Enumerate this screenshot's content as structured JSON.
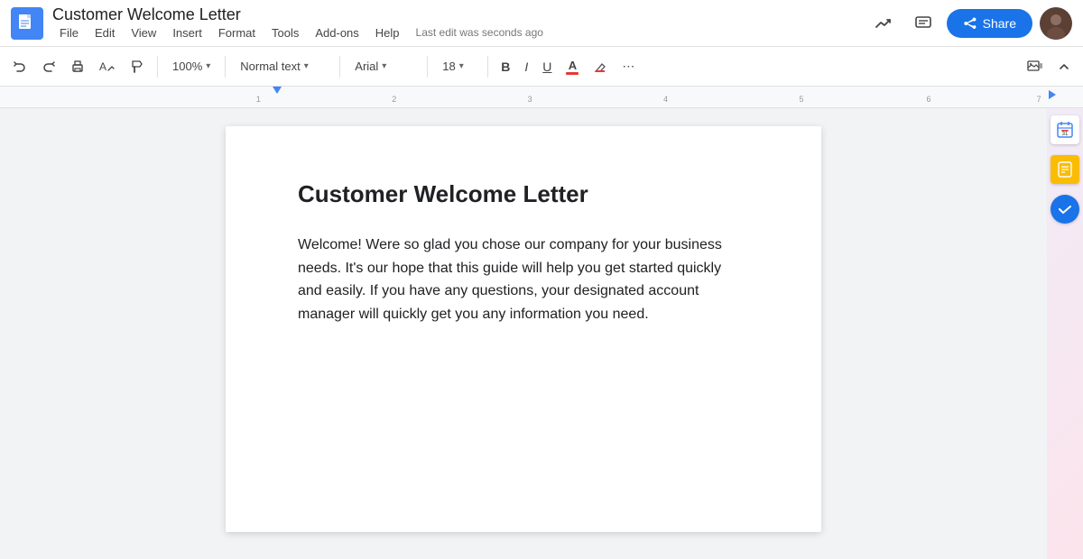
{
  "app": {
    "title": "Customer Welcome Letter",
    "doc_icon_color": "#4285f4",
    "last_edit": "Last edit was seconds ago"
  },
  "menu": {
    "items": [
      "File",
      "Edit",
      "View",
      "Insert",
      "Format",
      "Tools",
      "Add-ons",
      "Help"
    ]
  },
  "toolbar": {
    "zoom": "100%",
    "style": "Normal text",
    "font": "Arial",
    "size": "18",
    "bold": "B",
    "italic": "I",
    "underline": "U",
    "more": "⋯"
  },
  "share_button": {
    "label": "Share"
  },
  "document": {
    "title": "Customer Welcome Letter",
    "body": "Welcome! Were so glad you chose our company for your business needs. It's our hope that this guide will help you get started quickly and easily. If you have any questions, your designated account manager will quickly get you any information you need."
  },
  "ruler": {
    "marks": [
      "1",
      "2",
      "3",
      "4",
      "5",
      "6",
      "7"
    ]
  },
  "sidebar_icons": {
    "activities": "📈",
    "comments": "💬",
    "tasks": "✅"
  }
}
